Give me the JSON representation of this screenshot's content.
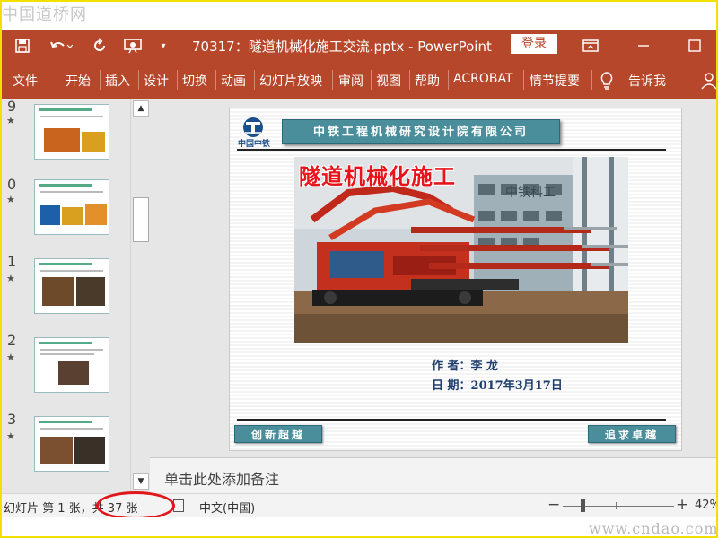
{
  "site": {
    "watermark": "中国道桥网",
    "footer_url": "www.cndao.com"
  },
  "titlebar": {
    "doc_title": "70317：隧道机械化施工交流.pptx  -  PowerPoint",
    "login_label": "登录",
    "icons": [
      "save-icon",
      "undo-icon",
      "redo-icon",
      "present-from-start-icon",
      "customize-quick-access-icon",
      "ribbon-display-options-icon",
      "minimize-icon",
      "maximize-icon"
    ]
  },
  "ribbon": {
    "tabs": [
      "文件",
      "开始",
      "插入",
      "设计",
      "切换",
      "动画",
      "幻灯片放映",
      "审阅",
      "视图",
      "帮助",
      "ACROBAT",
      "情节提要"
    ],
    "tell_me_label": "告诉我"
  },
  "thumbnails": [
    {
      "number": "9",
      "star": "★"
    },
    {
      "number": "0",
      "star": "★"
    },
    {
      "number": "1",
      "star": "★"
    },
    {
      "number": "2",
      "star": "★"
    },
    {
      "number": "3",
      "star": "★"
    }
  ],
  "slide": {
    "logo_text": "中国中铁",
    "company": "中铁工程机械研究设计院有限公司",
    "headline": "隧道机械化施工",
    "author": "作  者：李  龙",
    "date": "日  期：2017年3月17日",
    "button_left": "创新超越",
    "button_right": "追求卓越",
    "photo_sign": "中铁科工"
  },
  "notes": {
    "placeholder": "单击此处添加备注"
  },
  "status": {
    "slide_info": "幻灯片 第 1 张，共 37 张",
    "language": "中文(中国)",
    "zoom": "42%"
  },
  "colors": {
    "accent": "#b7472a",
    "slide_teal": "#4a8e9c",
    "headline_red": "#e8141c",
    "annotation_red": "#e0161b"
  }
}
